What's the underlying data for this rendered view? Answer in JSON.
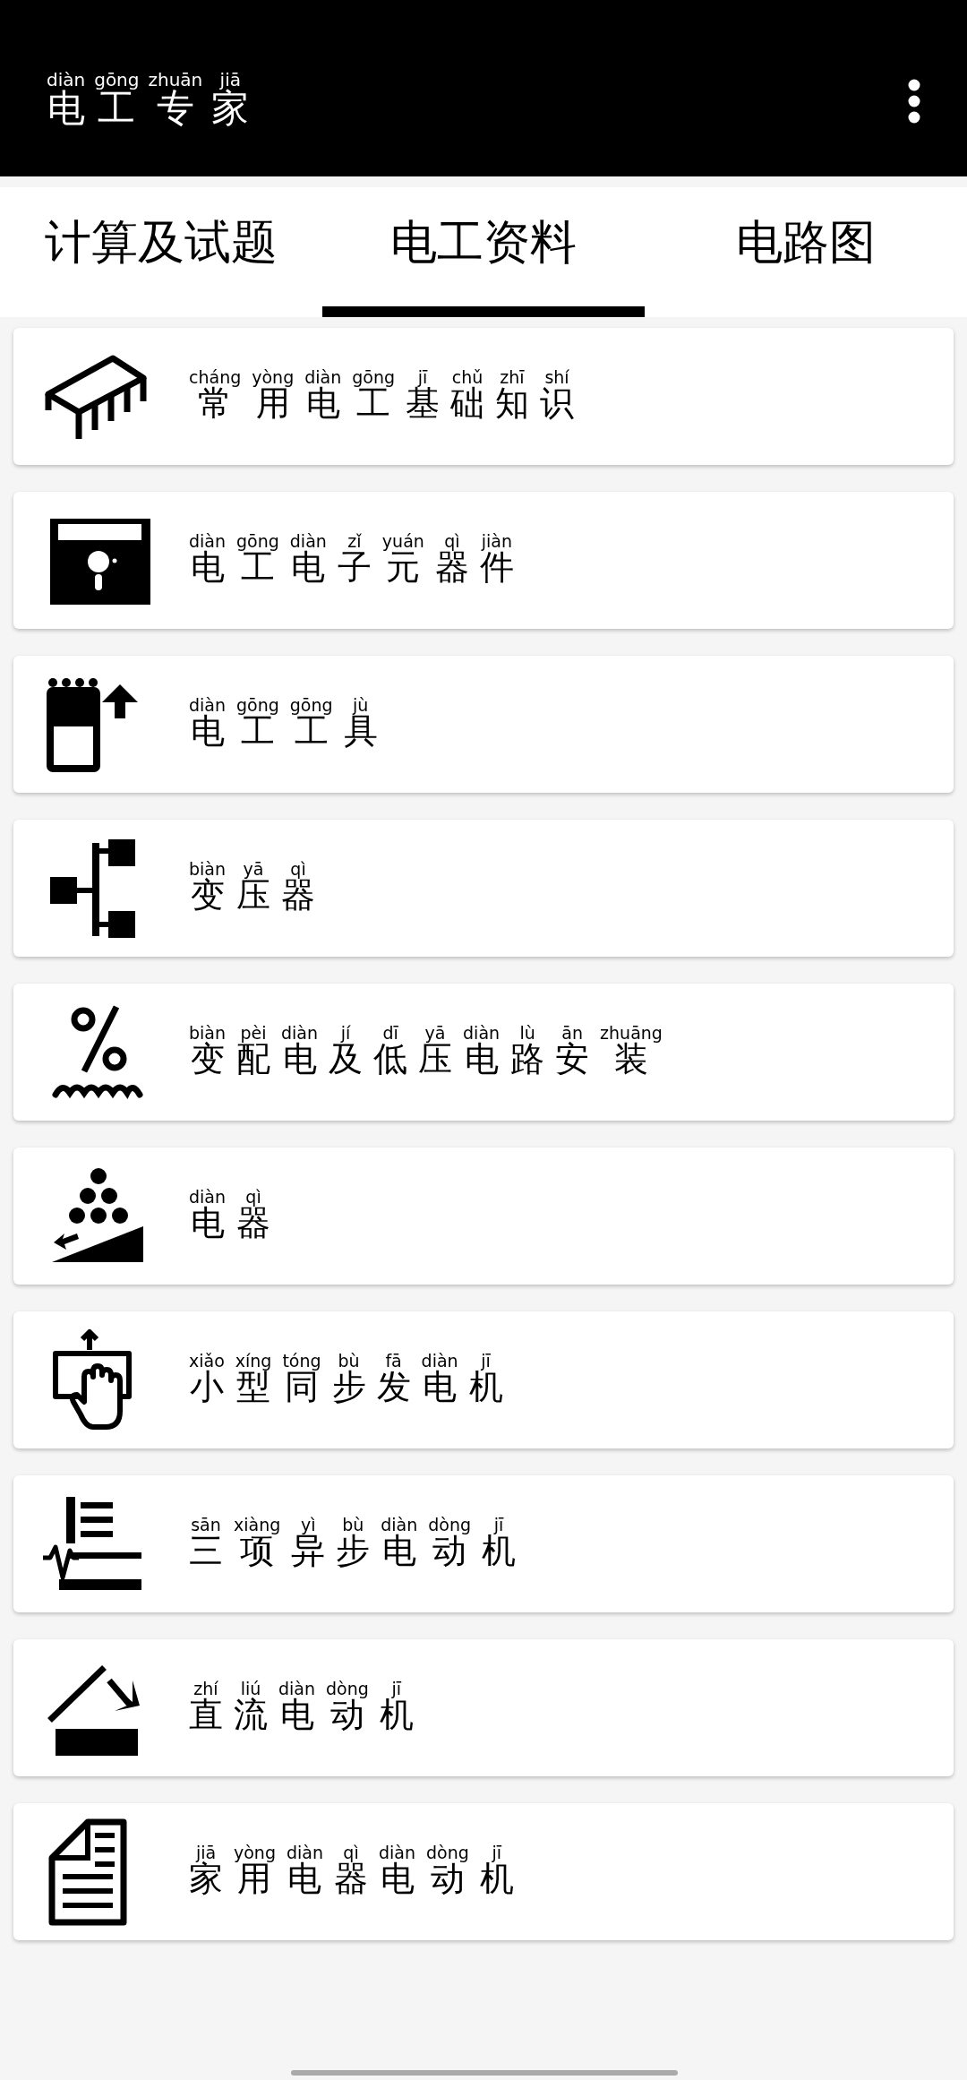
{
  "app_bar": {
    "title": [
      {
        "hanzi": "电",
        "pinyin": "diàn"
      },
      {
        "hanzi": "工",
        "pinyin": "gōng"
      },
      {
        "hanzi": "专",
        "pinyin": "zhuān"
      },
      {
        "hanzi": "家",
        "pinyin": "jiā"
      }
    ]
  },
  "tabs": [
    {
      "label": "计算及试题",
      "selected": false
    },
    {
      "label": "电工资料",
      "selected": true
    },
    {
      "label": "电路图",
      "selected": false
    }
  ],
  "items": [
    {
      "title": [
        {
          "hanzi": "常",
          "pinyin": "cháng"
        },
        {
          "hanzi": "用",
          "pinyin": "yòng"
        },
        {
          "hanzi": "电",
          "pinyin": "diàn"
        },
        {
          "hanzi": "工",
          "pinyin": "gōng"
        },
        {
          "hanzi": "基",
          "pinyin": "jī"
        },
        {
          "hanzi": "础",
          "pinyin": "chǔ"
        },
        {
          "hanzi": "知",
          "pinyin": "zhī"
        },
        {
          "hanzi": "识",
          "pinyin": "shí"
        }
      ]
    },
    {
      "title": [
        {
          "hanzi": "电",
          "pinyin": "diàn"
        },
        {
          "hanzi": "工",
          "pinyin": "gōng"
        },
        {
          "hanzi": "电",
          "pinyin": "diàn"
        },
        {
          "hanzi": "子",
          "pinyin": "zǐ"
        },
        {
          "hanzi": "元",
          "pinyin": "yuán"
        },
        {
          "hanzi": "器",
          "pinyin": "qì"
        },
        {
          "hanzi": "件",
          "pinyin": "jiàn"
        }
      ]
    },
    {
      "title": [
        {
          "hanzi": "电",
          "pinyin": "diàn"
        },
        {
          "hanzi": "工",
          "pinyin": "gōng"
        },
        {
          "hanzi": "工",
          "pinyin": "gōng"
        },
        {
          "hanzi": "具",
          "pinyin": "jù"
        }
      ]
    },
    {
      "title": [
        {
          "hanzi": "变",
          "pinyin": "biàn"
        },
        {
          "hanzi": "压",
          "pinyin": "yā"
        },
        {
          "hanzi": "器",
          "pinyin": "qì"
        }
      ]
    },
    {
      "title": [
        {
          "hanzi": "变",
          "pinyin": "biàn"
        },
        {
          "hanzi": "配",
          "pinyin": "pèi"
        },
        {
          "hanzi": "电",
          "pinyin": "diàn"
        },
        {
          "hanzi": "及",
          "pinyin": "jí"
        },
        {
          "hanzi": "低",
          "pinyin": "dī"
        },
        {
          "hanzi": "压",
          "pinyin": "yā"
        },
        {
          "hanzi": "电",
          "pinyin": "diàn"
        },
        {
          "hanzi": "路",
          "pinyin": "lù"
        },
        {
          "hanzi": "安",
          "pinyin": "ān"
        },
        {
          "hanzi": "装",
          "pinyin": "zhuāng"
        }
      ]
    },
    {
      "title": [
        {
          "hanzi": "电",
          "pinyin": "diàn"
        },
        {
          "hanzi": "器",
          "pinyin": "qì"
        }
      ]
    },
    {
      "title": [
        {
          "hanzi": "小",
          "pinyin": "xiǎo"
        },
        {
          "hanzi": "型",
          "pinyin": "xíng"
        },
        {
          "hanzi": "同",
          "pinyin": "tóng"
        },
        {
          "hanzi": "步",
          "pinyin": "bù"
        },
        {
          "hanzi": "发",
          "pinyin": "fā"
        },
        {
          "hanzi": "电",
          "pinyin": "diàn"
        },
        {
          "hanzi": "机",
          "pinyin": "jī"
        }
      ]
    },
    {
      "title": [
        {
          "hanzi": "三",
          "pinyin": "sān"
        },
        {
          "hanzi": "项",
          "pinyin": "xiàng"
        },
        {
          "hanzi": "异",
          "pinyin": "yì"
        },
        {
          "hanzi": "步",
          "pinyin": "bù"
        },
        {
          "hanzi": "电",
          "pinyin": "diàn"
        },
        {
          "hanzi": "动",
          "pinyin": "dòng"
        },
        {
          "hanzi": "机",
          "pinyin": "jī"
        }
      ]
    },
    {
      "title": [
        {
          "hanzi": "直",
          "pinyin": "zhí"
        },
        {
          "hanzi": "流",
          "pinyin": "liú"
        },
        {
          "hanzi": "电",
          "pinyin": "diàn"
        },
        {
          "hanzi": "动",
          "pinyin": "dòng"
        },
        {
          "hanzi": "机",
          "pinyin": "jī"
        }
      ]
    },
    {
      "title": [
        {
          "hanzi": "家",
          "pinyin": "jiā"
        },
        {
          "hanzi": "用",
          "pinyin": "yòng"
        },
        {
          "hanzi": "电",
          "pinyin": "diàn"
        },
        {
          "hanzi": "器",
          "pinyin": "qì"
        },
        {
          "hanzi": "电",
          "pinyin": "diàn"
        },
        {
          "hanzi": "动",
          "pinyin": "dòng"
        },
        {
          "hanzi": "机",
          "pinyin": "jī"
        }
      ]
    }
  ]
}
